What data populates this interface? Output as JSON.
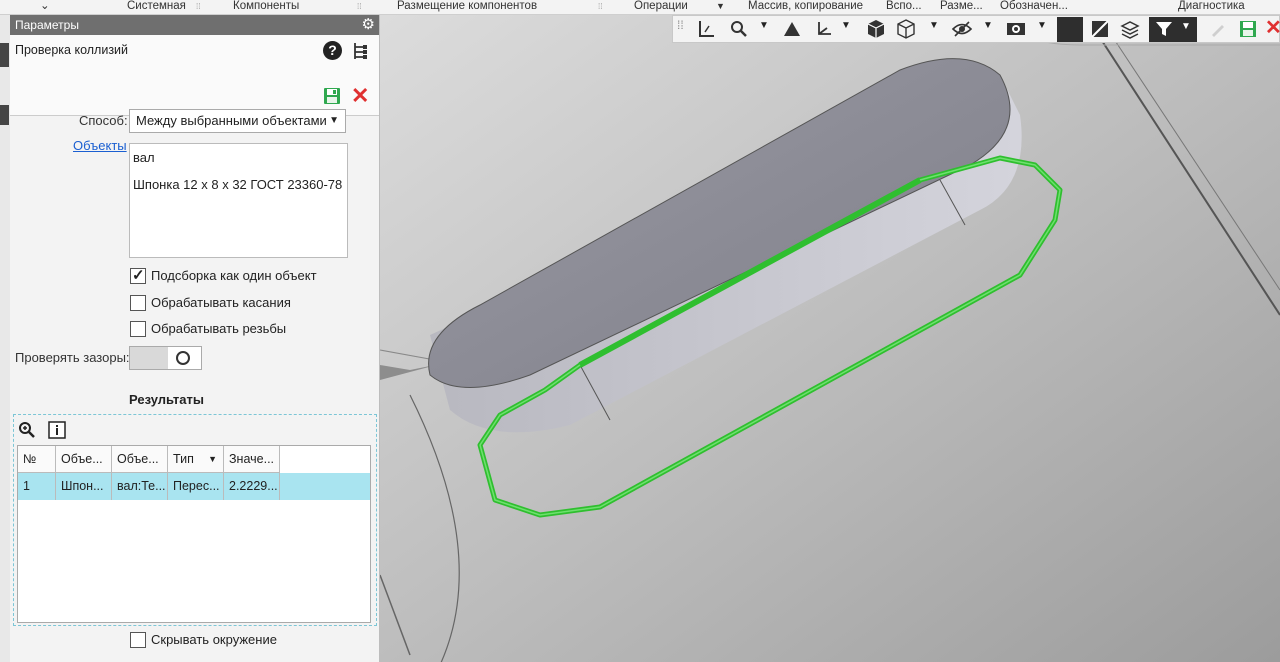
{
  "ribbon": {
    "sections": [
      "Системная",
      "Компоненты",
      "Размещение компонентов",
      "Операции",
      "Массив, копирование",
      "Вспо...",
      "Разме...",
      "Обозначен...",
      "Диагностика"
    ]
  },
  "panel": {
    "header": "Параметры",
    "command_title": "Проверка коллизий",
    "method_label": "Способ:",
    "method_value": "Между выбранными объектами",
    "objects_link": "Объекты",
    "objects": [
      "вал",
      "Шпонка 12 x 8 x 32 ГОСТ 23360-78"
    ],
    "options": [
      {
        "label": "Подсборка как один объект",
        "checked": true
      },
      {
        "label": "Обрабатывать касания",
        "checked": false
      },
      {
        "label": "Обрабатывать резьбы",
        "checked": false
      }
    ],
    "gap_label": "Проверять зазоры:",
    "results_title": "Результаты",
    "table": {
      "headers": [
        "№",
        "Объе...",
        "Объе...",
        "Тип",
        "Значе..."
      ],
      "rows": [
        [
          "1",
          "Шпон...",
          "вал:Те...",
          "Перес...",
          "2.2229..."
        ]
      ]
    },
    "hide_env_label": "Скрывать окружение"
  },
  "colors": {
    "accent_green": "#2fbf2f",
    "selection": "#a9e4f0",
    "header_bg": "#6f6f6f",
    "close_red": "#e03030"
  },
  "icons": [
    "gear-icon",
    "help-icon",
    "tree-icon",
    "save-icon",
    "close-icon",
    "zoom-icon",
    "info-icon",
    "filter-icon"
  ]
}
